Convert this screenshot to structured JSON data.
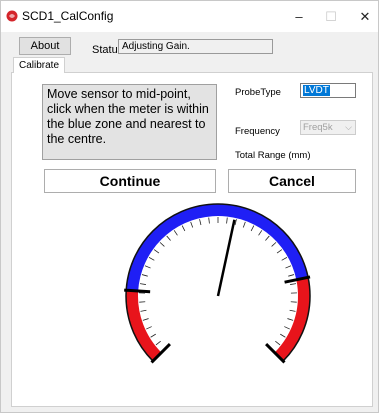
{
  "window": {
    "title": "SCD1_CalConfig",
    "minimize": "–",
    "maximize": "☐",
    "close": "✕"
  },
  "toolbar": {
    "about_label": "About",
    "status_label": "Status",
    "status_value": "Adjusting Gain."
  },
  "tabs": [
    {
      "label": "Calibrate",
      "active": true
    }
  ],
  "calibrate": {
    "instruction": "Move sensor to mid-point, click when the meter is within the blue zone and nearest to the centre.",
    "probe_type_label": "ProbeType",
    "probe_type_value": "LVDT",
    "frequency_label": "Frequency",
    "frequency_value": "Freq5k",
    "total_range_label": "Total Range (mm)",
    "continue_label": "Continue",
    "cancel_label": "Cancel"
  },
  "meter": {
    "zones": [
      {
        "name": "red-left",
        "color": "#e8141b"
      },
      {
        "name": "blue-center",
        "color": "#1f1ff5"
      },
      {
        "name": "red-right",
        "color": "#e8141b"
      }
    ],
    "needle_level": 0.545
  },
  "colors": {
    "selection": "#0078d7",
    "zone_red": "#e8141b",
    "zone_blue": "#1f1ff5"
  }
}
